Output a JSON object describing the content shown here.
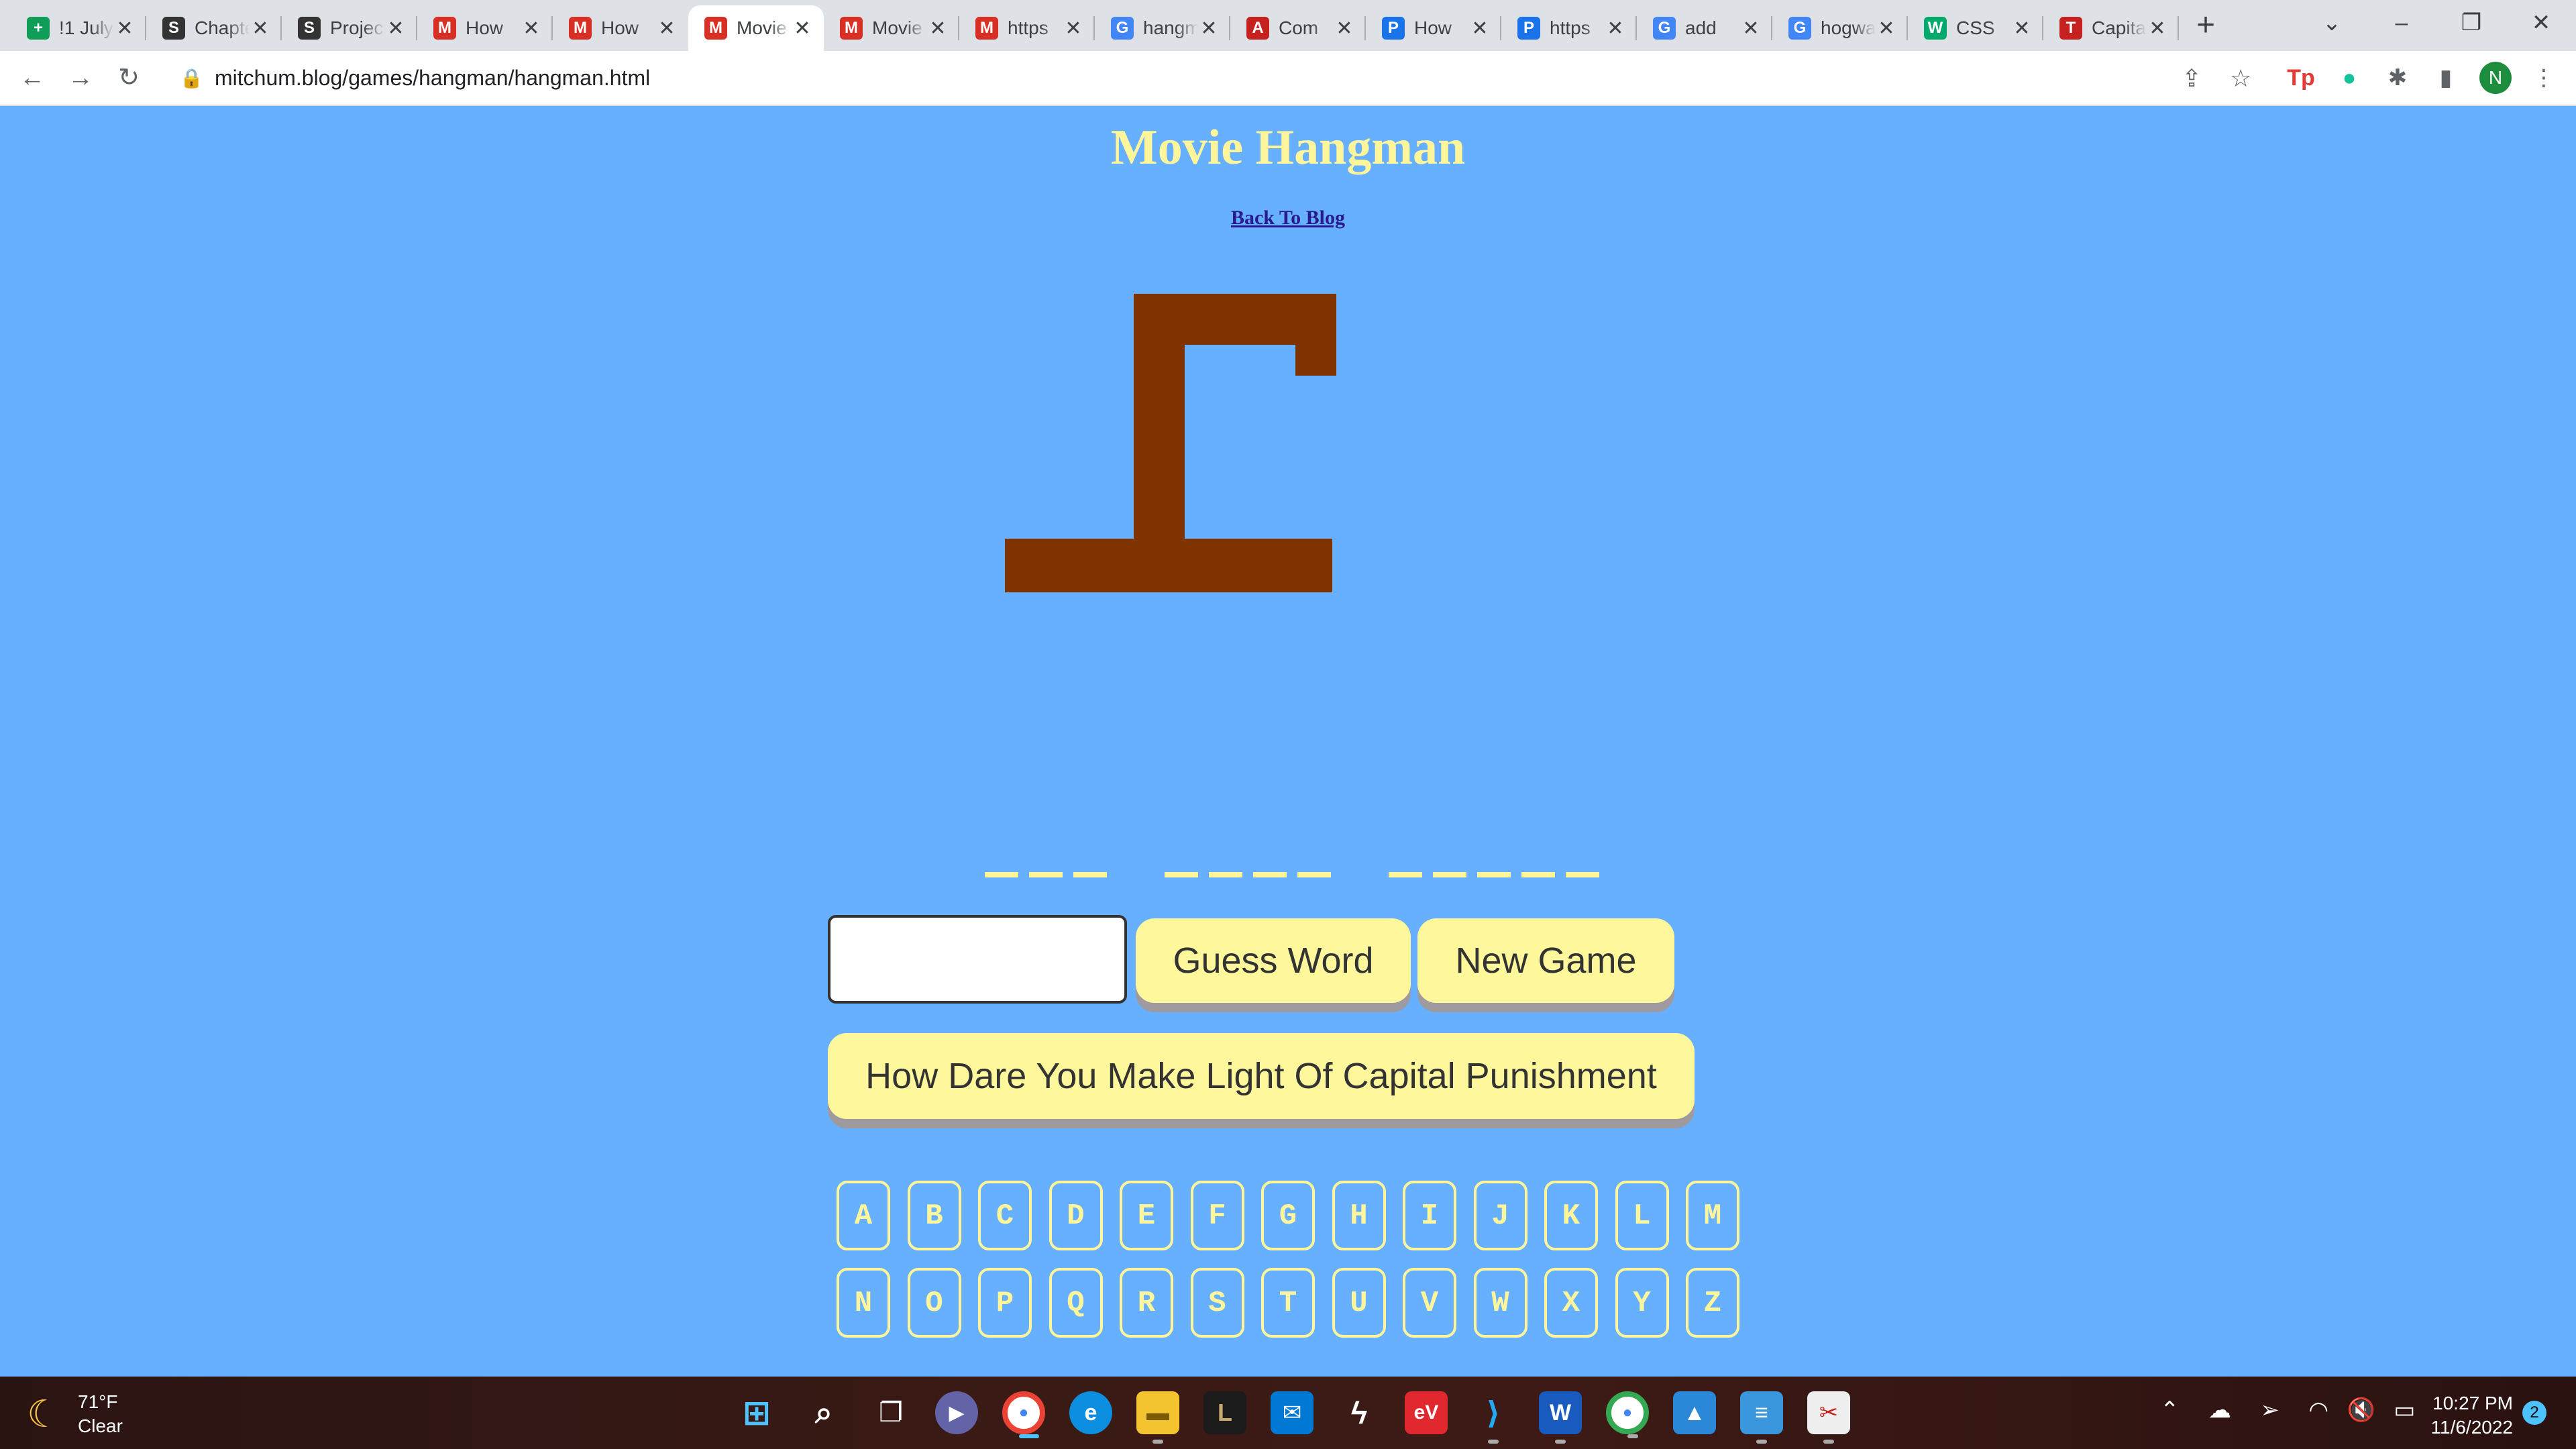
{
  "browser": {
    "tabs": [
      {
        "title": "!1 July",
        "icon": "sheets-icon",
        "color": "#0f9d58",
        "glyph": "+"
      },
      {
        "title": "Chapter",
        "icon": "s-icon",
        "color": "#333333",
        "glyph": "S"
      },
      {
        "title": "Project",
        "icon": "s-icon",
        "color": "#333333",
        "glyph": "S"
      },
      {
        "title": "How",
        "icon": "mb-icon",
        "color": "#d93025",
        "glyph": "M"
      },
      {
        "title": "How",
        "icon": "mb-icon",
        "color": "#d93025",
        "glyph": "M"
      },
      {
        "title": "Movie",
        "icon": "mb-icon",
        "color": "#d93025",
        "glyph": "M",
        "active": true
      },
      {
        "title": "Movie",
        "icon": "mb-icon",
        "color": "#d93025",
        "glyph": "M"
      },
      {
        "title": "https",
        "icon": "mb-icon",
        "color": "#d93025",
        "glyph": "M"
      },
      {
        "title": "hangman",
        "icon": "google-icon",
        "color": "#4285f4",
        "glyph": "G"
      },
      {
        "title": "Com",
        "icon": "adobe-icon",
        "color": "#c5221f",
        "glyph": "A"
      },
      {
        "title": "How",
        "icon": "p-icon",
        "color": "#1a73e8",
        "glyph": "P"
      },
      {
        "title": "https",
        "icon": "p-icon",
        "color": "#1a73e8",
        "glyph": "P"
      },
      {
        "title": "add",
        "icon": "google-icon",
        "color": "#4285f4",
        "glyph": "G"
      },
      {
        "title": "hogwarts",
        "icon": "google-icon",
        "color": "#4285f4",
        "glyph": "G"
      },
      {
        "title": "CSS",
        "icon": "w3-icon",
        "color": "#04aa6d",
        "glyph": "W"
      },
      {
        "title": "Capital",
        "icon": "t-icon",
        "color": "#c5221f",
        "glyph": "T"
      }
    ],
    "url_host": "mitchum.blog",
    "url_path": "/games/hangman/hangman.html",
    "profile_initial": "N"
  },
  "page": {
    "title": "Movie Hangman",
    "back_link": "Back To Blog",
    "word_pattern": [
      3,
      4,
      5
    ],
    "guess_input_value": "",
    "guess_button": "Guess Word",
    "new_game_button": "New Game",
    "hint": "How Dare You Make Light Of Capital Punishment",
    "letters_row1": [
      "A",
      "B",
      "C",
      "D",
      "E",
      "F",
      "G",
      "H",
      "I",
      "J",
      "K",
      "L",
      "M"
    ],
    "letters_row2": [
      "N",
      "O",
      "P",
      "Q",
      "R",
      "S",
      "T",
      "U",
      "V",
      "W",
      "X",
      "Y",
      "Z"
    ],
    "colors": {
      "background": "#66b0ff",
      "accent": "#fff59a",
      "gallows": "#7f3300",
      "button": "#fff79b"
    }
  },
  "taskbar": {
    "weather_temp": "71°F",
    "weather_desc": "Clear",
    "time": "10:27 PM",
    "date": "11/6/2022",
    "notification_count": "2"
  }
}
